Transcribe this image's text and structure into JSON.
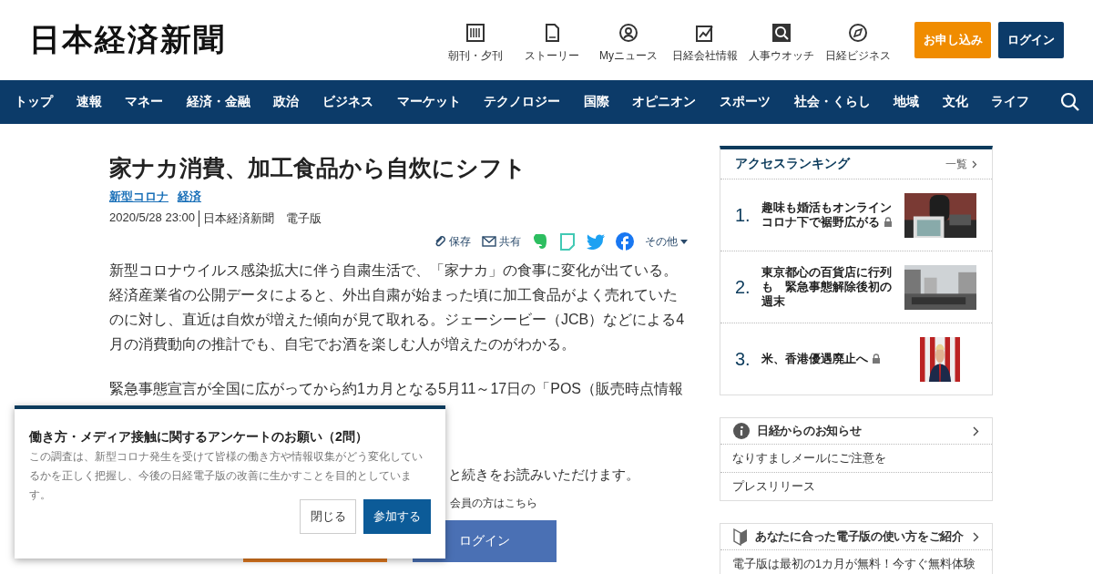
{
  "header": {
    "logo": "日本経済新聞",
    "services": [
      {
        "kind": "paper",
        "label": "朝刊・夕刊"
      },
      {
        "kind": "story",
        "label": "ストーリー"
      },
      {
        "kind": "my",
        "label": "Myニュース"
      },
      {
        "kind": "company",
        "label": "日経会社情報"
      },
      {
        "kind": "hr",
        "label": "人事ウオッチ"
      },
      {
        "kind": "business",
        "label": "日経ビジネス"
      }
    ],
    "subscribe_button": "お申し込み",
    "login_button": "ログイン"
  },
  "nav": [
    "トップ",
    "速報",
    "マネー",
    "経済・金融",
    "政治",
    "ビジネス",
    "マーケット",
    "テクノロジー",
    "国際",
    "オピニオン",
    "スポーツ",
    "社会・くらし",
    "地域",
    "文化",
    "ライフ"
  ],
  "article": {
    "title": "家ナカ消費、加工食品から自炊にシフト",
    "topics": [
      "新型コロナ",
      "経済"
    ],
    "date": "2020/5/28 23:00",
    "source": "日本経済新聞　電子版",
    "share": [
      {
        "kind": "save",
        "label": "保存"
      },
      {
        "kind": "mail",
        "label": "共有"
      },
      {
        "kind": "evernote"
      },
      {
        "kind": "note"
      },
      {
        "kind": "twitter"
      },
      {
        "kind": "facebook"
      },
      {
        "kind": "more",
        "label": "その他"
      }
    ],
    "paragraphs": [
      "新型コロナウイルス感染拡大に伴う自粛生活で、「家ナカ」の食事に変化が出ている。経済産業省の公開データによると、外出自粛が始まった頃に加工食品がよく売れていたのに対し、直近は自炊が増えた傾向が見て取れる。ジェーシービー（JCB）などによる4月の消費動向の推計でも、自宅でお酒を楽しむ人が増えたのがわかる。",
      "緊急事態宣言が全国に広がってから約1カ月となる5月11～17日の「POS（販売時点情報"
    ],
    "paywall_text": "と続きをお読みいただけます。",
    "member_text": "会員の方はこちら",
    "login_button": "ログイン"
  },
  "survey": {
    "title": "働き方・メディア接触に関するアンケートのお願い（2問）",
    "body": "この調査は、新型コロナ発生を受けて皆様の働き方や情報収集がどう変化しているかを正しく把握し、今後の日経電子版の改善に生かすことを目的としています。",
    "close_button": "閉じる",
    "join_button": "参加する"
  },
  "ranking": {
    "title": "アクセスランキング",
    "more": "一覧",
    "items": [
      {
        "rank": "1.",
        "title": "趣味も婚活もオンラインコロナ下で裾野広がる",
        "locked": true,
        "kind": "picture"
      },
      {
        "rank": "2.",
        "title": "東京都心の百貨店に行列も　緊急事態解除後初の週末",
        "locked": false,
        "kind": "picture"
      },
      {
        "rank": "3.",
        "title": "米、香港優遇廃止へ",
        "locked": true,
        "kind": "picture"
      }
    ]
  },
  "notices": {
    "title": "日経からのお知らせ",
    "items": [
      "なりすましメールにご注意を",
      "プレスリリース"
    ]
  },
  "guide": {
    "title": "あなたに合った電子版の使い方をご紹介",
    "items": [
      "電子版は最初の1カ月が無料！今すぐ無料体験"
    ]
  }
}
